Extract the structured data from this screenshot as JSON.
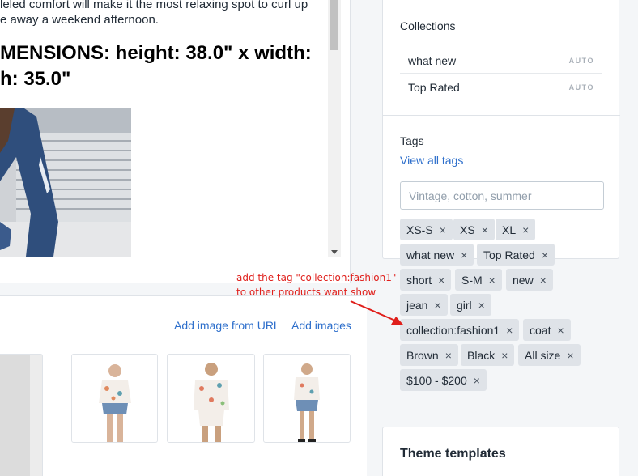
{
  "description": {
    "line1": "leled comfort will make it the most relaxing spot to curl up",
    "line2": "e away a weekend afternoon.",
    "dimensions_line1": "MENSIONS: height: 38.0\" x width:",
    "dimensions_line2": "h: 35.0\""
  },
  "media": {
    "add_url_label": "Add image from URL",
    "add_images_label": "Add images"
  },
  "collections": {
    "title": "Collections",
    "items": [
      {
        "name": "what new",
        "badge": "AUTO"
      },
      {
        "name": "Top Rated",
        "badge": "AUTO"
      }
    ]
  },
  "tags": {
    "title": "Tags",
    "view_all_label": "View all tags",
    "input_placeholder": "Vintage, cotton, summer",
    "remove_glyph": "×",
    "chips": [
      "XS-S",
      "XS",
      "XL",
      "what new",
      "Top Rated",
      "short",
      "S-M",
      "new",
      "jean",
      "girl",
      "collection:fashion1",
      "coat",
      "Brown",
      "Black",
      "All size",
      "$100 - $200"
    ]
  },
  "theme": {
    "title": "Theme templates"
  },
  "annotation": {
    "line1": "add the tag \"collection:fashion1\"",
    "line2": "to other products want show",
    "color": "#e0201c"
  },
  "colors": {
    "link": "#2c6ecb",
    "chip_bg": "#dfe3e8",
    "page_bg": "#f4f6f8"
  }
}
